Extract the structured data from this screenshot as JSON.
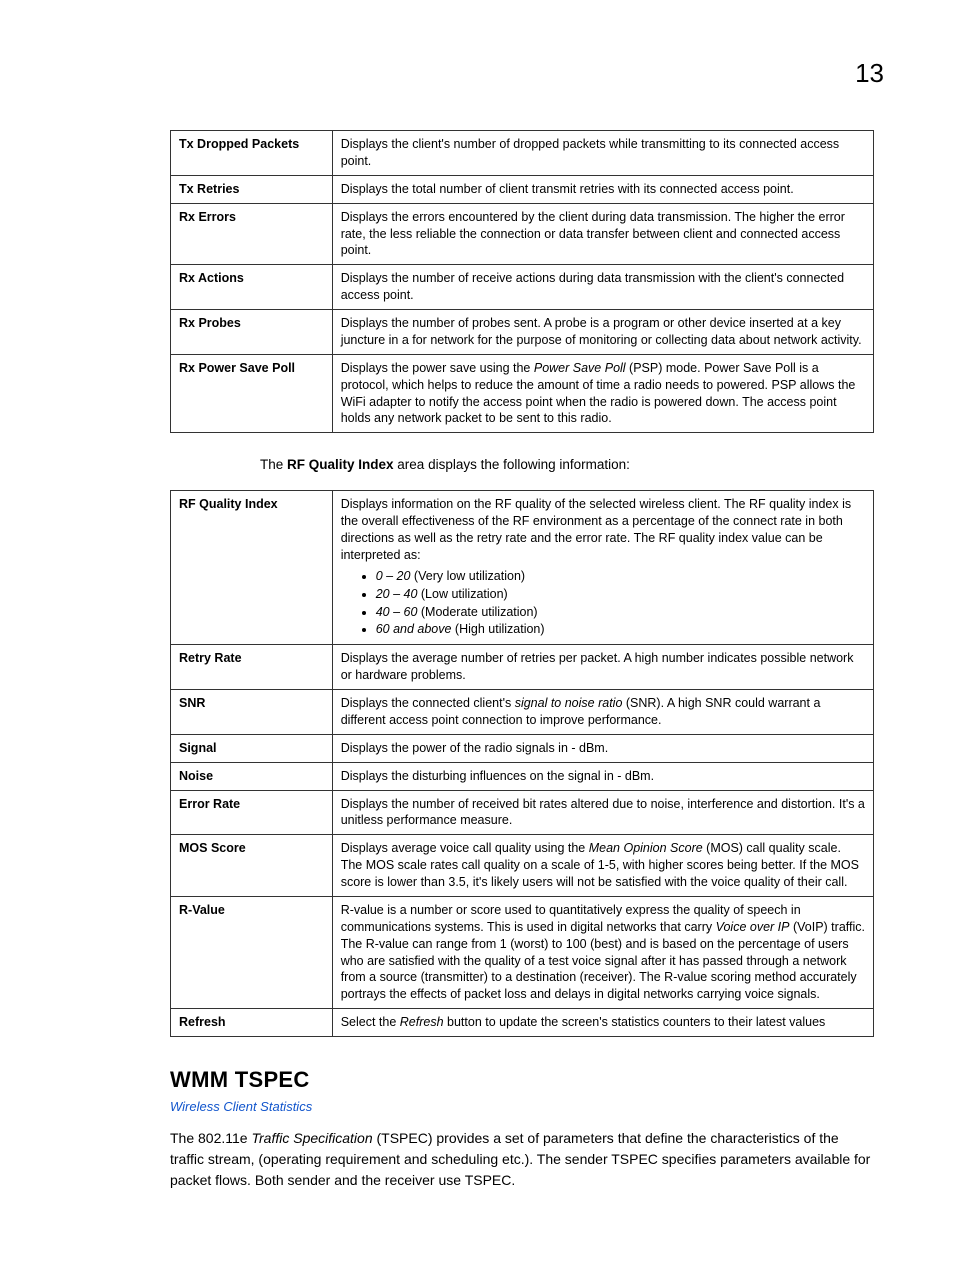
{
  "pageNumber": "13",
  "table1": {
    "rows": [
      {
        "term": "Tx Dropped Packets",
        "desc": "Displays the client's number of dropped packets while transmitting to its connected access point."
      },
      {
        "term": "Tx Retries",
        "desc": "Displays the total number of client transmit retries with its connected access point."
      },
      {
        "term": "Rx Errors",
        "desc": "Displays the errors encountered by the client during data transmission. The higher the error rate, the less reliable the connection or data transfer between client and connected access point."
      },
      {
        "term": "Rx Actions",
        "desc": "Displays the number of receive actions during data transmission with the client's connected access point."
      },
      {
        "term": "Rx Probes",
        "desc": "Displays the number of probes sent. A probe is a program or other device inserted at a key juncture in a for network for the purpose of monitoring or collecting data about network activity."
      },
      {
        "term": "Rx Power Save Poll",
        "desc_pre": "Displays the power save using the ",
        "desc_ital": "Power Save Poll",
        "desc_post": " (PSP) mode. Power Save Poll is a protocol, which helps to reduce the amount of time a radio needs to powered. PSP allows the WiFi adapter to notify the access point when the radio is powered down. The access point holds any network packet to be sent to this radio."
      }
    ]
  },
  "introLine": {
    "pre": "The ",
    "bold": "RF Quality Index",
    "post": " area displays the following information:"
  },
  "table2": {
    "rfQuality": {
      "term": "RF Quality Index",
      "intro": "Displays information on the RF quality of the selected wireless client. The RF quality index is the overall effectiveness of the RF environment as a percentage of the connect rate in both directions as well as the retry rate and the error rate. The RF quality index value can be interpreted as:",
      "bullets": [
        {
          "ital": "0 – 20",
          "rest": " (Very low utilization)"
        },
        {
          "ital": "20 – 40",
          "rest": " (Low utilization)"
        },
        {
          "ital": "40 – 60",
          "rest": " (Moderate utilization)"
        },
        {
          "ital": "60 and above",
          "rest": " (High utilization)"
        }
      ]
    },
    "retryRate": {
      "term": "Retry Rate",
      "desc": "Displays the average number of retries per packet. A high number indicates possible network or hardware problems."
    },
    "snr": {
      "term": "SNR",
      "desc_pre": "Displays the connected client's ",
      "desc_ital": "signal to noise ratio",
      "desc_post": " (SNR). A high SNR could warrant a different access point connection to improve performance."
    },
    "signal": {
      "term": "Signal",
      "desc": "Displays the power of the radio signals in - dBm."
    },
    "noise": {
      "term": "Noise",
      "desc": "Displays the disturbing influences on the signal in - dBm."
    },
    "errorRate": {
      "term": "Error Rate",
      "desc": "Displays the number of received bit rates altered due to noise, interference and distortion. It's a unitless performance measure."
    },
    "mos": {
      "term": "MOS Score",
      "desc_pre": "Displays average voice call quality using the ",
      "desc_ital": "Mean Opinion Score",
      "desc_post": " (MOS) call quality scale. The MOS scale rates call quality on a scale of 1-5, with higher scores being better. If the MOS score is lower than 3.5, it's likely users will not be satisfied with the voice quality of their call."
    },
    "rvalue": {
      "term": "R-Value",
      "desc_pre": "R-value is a number or score used to quantitatively express the quality of speech in communications systems. This is used in digital networks that carry ",
      "desc_ital": "Voice over IP",
      "desc_post": " (VoIP) traffic. The R-value can range from 1 (worst) to 100 (best) and is based on the percentage of users who are satisfied with the quality of a test voice signal after it has passed through a network from a source (transmitter) to a destination (receiver). The R-value scoring method accurately portrays the effects of packet loss and delays in digital networks carrying voice signals."
    },
    "refresh": {
      "term": "Refresh",
      "desc_pre": "Select the ",
      "desc_ital": "Refresh",
      "desc_post": " button to update the screen's statistics counters to their latest values"
    }
  },
  "section": {
    "title": "WMM TSPEC",
    "subtitle": "Wireless Client Statistics",
    "body_pre": "The 802.11e ",
    "body_ital": "Traffic Specification",
    "body_post": " (TSPEC) provides a set of parameters that define the characteristics of the traffic stream, (operating requirement and scheduling etc.). The sender TSPEC specifies parameters available for packet flows. Both sender and the receiver use TSPEC."
  }
}
